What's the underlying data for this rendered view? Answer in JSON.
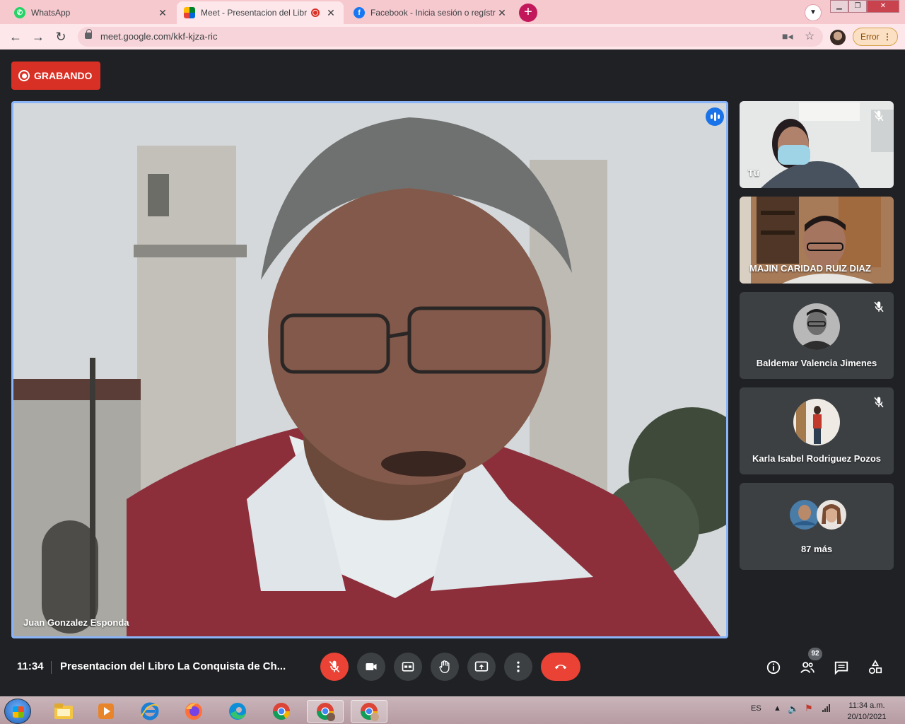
{
  "browser": {
    "tabs": [
      {
        "title": "WhatsApp",
        "favicon": "whatsapp-icon",
        "color": "#25d366"
      },
      {
        "title": "Meet - Presentacion del Libr",
        "favicon": "google-meet-icon",
        "recording": true
      },
      {
        "title": "Facebook - Inicia sesión o regístr",
        "favicon": "facebook-icon",
        "color": "#1877f2"
      }
    ],
    "url": "meet.google.com/kkf-kjza-ric",
    "error_label": "Error"
  },
  "meet": {
    "recording_label": "GRABANDO",
    "main_speaker": "Juan Gonzalez Esponda",
    "participants": [
      {
        "name": "Tú",
        "muted": true
      },
      {
        "name": "MAJIN CARIDAD RUIZ DIAZ",
        "muted": false
      },
      {
        "name": "Baldemar Valencia Jimenes",
        "muted": true
      },
      {
        "name": "Karla Isabel Rodriguez Pozos",
        "muted": true
      }
    ],
    "more_label": "87 más",
    "time": "11:34",
    "meeting_title": "Presentacion del Libro La Conquista de Ch...",
    "participant_count": "92",
    "accent_color": "#8ab4f8",
    "danger_color": "#ea4335"
  },
  "taskbar": {
    "language": "ES",
    "clock_time": "11:34 a.m.",
    "clock_date": "20/10/2021"
  }
}
